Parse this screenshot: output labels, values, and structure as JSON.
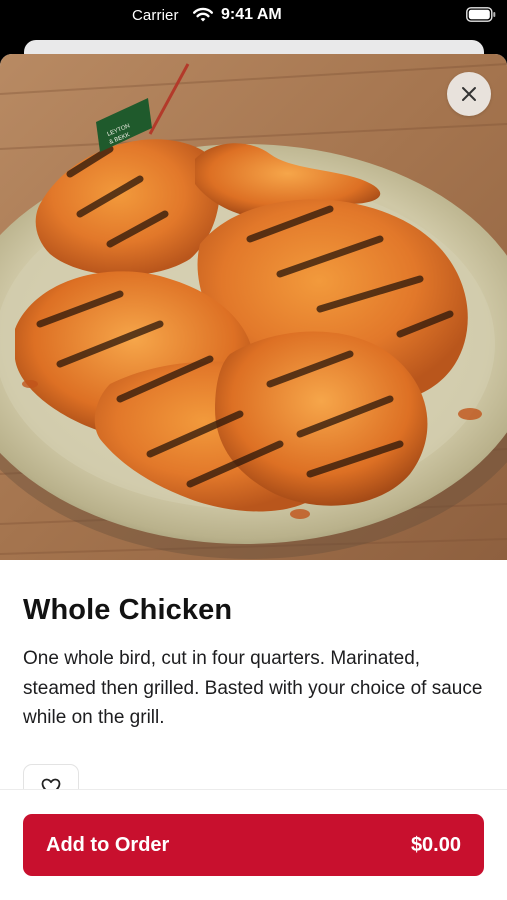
{
  "status_bar": {
    "carrier": "Carrier",
    "time": "9:41 AM",
    "icons": [
      "wifi-icon",
      "battery-icon"
    ]
  },
  "hero": {
    "image": "grilled-whole-chicken-photo",
    "flag_text": "LEYTON & BEKK",
    "close_icon": "close-icon"
  },
  "item": {
    "title": "Whole Chicken",
    "description": "One whole bird, cut in four quarters. Marinated, steamed then grilled. Basted with your choice of sauce while on the grill.",
    "favorite_icon": "heart-outline-icon"
  },
  "footer": {
    "add_label": "Add to Order",
    "price": "$0.00"
  },
  "colors": {
    "accent": "#c8102e",
    "text": "#121212",
    "background": "#ffffff",
    "status_bar": "#000000"
  }
}
